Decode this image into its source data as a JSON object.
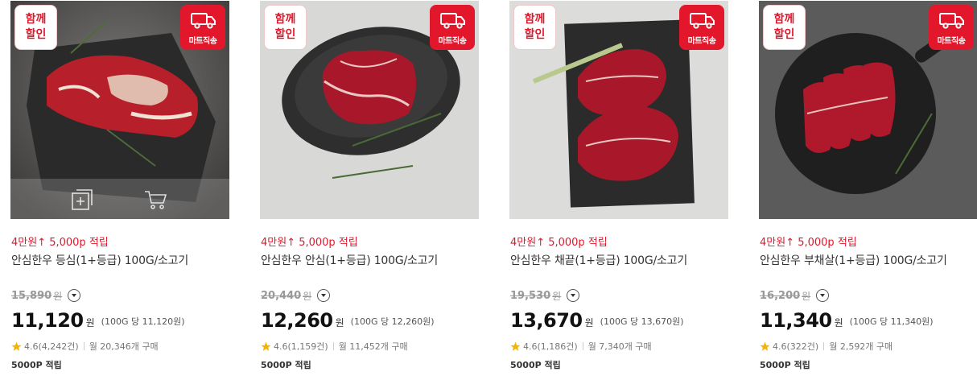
{
  "badges": {
    "together": [
      "함께",
      "할인"
    ],
    "direct_delivery": "마트직송"
  },
  "products": [
    {
      "promo": "4만원↑ 5,000p 적립",
      "title": "안심한우 등심(1+등급) 100G/소고기",
      "original_price": "15,890",
      "original_unit": "원",
      "price": "11,120",
      "price_unit": "원",
      "unit_price": "(100G 당 11,120원)",
      "rating": "4.6(4,242건)",
      "monthly_sales": "월 20,346개 구매",
      "points": "5000P 적립",
      "image_icon": "beef-sirloin-image"
    },
    {
      "promo": "4만원↑ 5,000p 적립",
      "title": "안심한우 안심(1+등급) 100G/소고기",
      "original_price": "20,440",
      "original_unit": "원",
      "price": "12,260",
      "price_unit": "원",
      "unit_price": "(100G 당 12,260원)",
      "rating": "4.6(1,159건)",
      "monthly_sales": "월 11,452개 구매",
      "points": "5000P 적립",
      "image_icon": "beef-tenderloin-image"
    },
    {
      "promo": "4만원↑ 5,000p 적립",
      "title": "안심한우 채끝(1+등급) 100G/소고기",
      "original_price": "19,530",
      "original_unit": "원",
      "price": "13,670",
      "price_unit": "원",
      "unit_price": "(100G 당 13,670원)",
      "rating": "4.6(1,186건)",
      "monthly_sales": "월 7,340개 구매",
      "points": "5000P 적립",
      "image_icon": "beef-striploin-image"
    },
    {
      "promo": "4만원↑ 5,000p 적립",
      "title": "안심한우 부채살(1+등급) 100G/소고기",
      "original_price": "16,200",
      "original_unit": "원",
      "price": "11,340",
      "price_unit": "원",
      "unit_price": "(100G 당 11,340원)",
      "rating": "4.6(322건)",
      "monthly_sales": "월 2,592개 구매",
      "points": "5000P 적립",
      "image_icon": "beef-top-blade-image"
    }
  ],
  "colors": {
    "accent_red": "#e3172b",
    "star": "#f5b301"
  }
}
